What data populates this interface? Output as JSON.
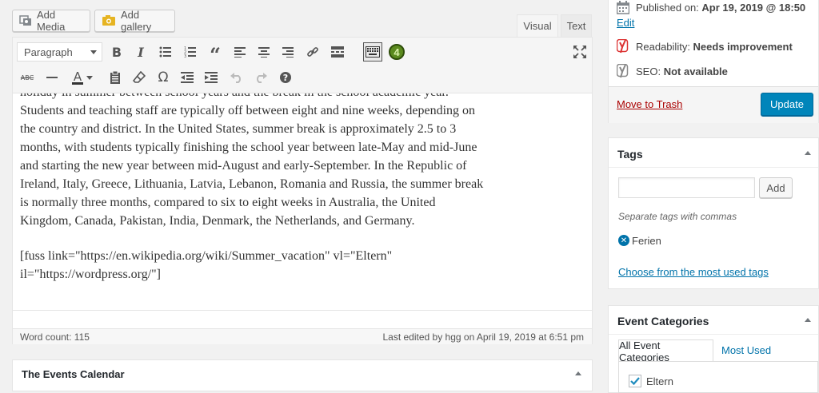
{
  "media_buttons": {
    "add_media": "Add Media",
    "add_gallery": "Add gallery"
  },
  "editor_tabs": {
    "visual": "Visual",
    "text": "Text"
  },
  "toolbar": {
    "format_select": "Paragraph",
    "accent_color": "#555d66",
    "plugin_badge_color": "#5b8a1e",
    "plugin_badge_label": "4"
  },
  "content": {
    "lines_para1": [
      "holiday in summer between school years and the break in the school academic year.",
      "Students and teaching staff are typically off between eight and nine weeks, depending on",
      "the country and district. In the United States, summer break is approximately 2.5 to 3",
      "months, with students typically finishing the school year between late-May and mid-June",
      "and starting the new year between mid-August and early-September. In the Republic of",
      "Ireland, Italy, Greece, Lithuania, Latvia, Lebanon, Romania and Russia, the summer break",
      "is normally three months, compared to six to eight weeks in Australia, the United",
      "Kingdom, Canada, Pakistan, India, Denmark, the Netherlands, and Germany."
    ],
    "lines_para2": [
      "[fuss link=\"https://en.wikipedia.org/wiki/Summer_vacation\" vl=\"Eltern\"",
      "il=\"https://wordpress.org/\"]"
    ]
  },
  "status": {
    "word_count": "Word count: 115",
    "last_edited": "Last edited by hgg on April 19, 2019 at 6:51 pm"
  },
  "events_calendar": {
    "title": "The Events Calendar"
  },
  "publish": {
    "published_label": "Published on: ",
    "published_date": "Apr 19, 2019 @ 18:50",
    "edit_link": "Edit",
    "readability_label": "Readability: ",
    "readability_value": "Needs improvement",
    "seo_label": "SEO: ",
    "seo_value": "Not available",
    "trash_link": "Move to Trash",
    "update_button": "Update"
  },
  "tags": {
    "title": "Tags",
    "input_value": "",
    "add_button": "Add",
    "hint": "Separate tags with commas",
    "tag_items": [
      "Ferien"
    ],
    "choose_link": "Choose from the most used tags"
  },
  "event_categories": {
    "title": "Event Categories",
    "tab_all": "All Event Categories",
    "tab_most_used": "Most Used",
    "items": [
      {
        "label": "Eltern",
        "checked": true
      }
    ]
  },
  "colors": {
    "primary_button": "#0085ba",
    "link": "#0073aa",
    "trash": "#a00",
    "readability_icon": "#dc3232"
  }
}
